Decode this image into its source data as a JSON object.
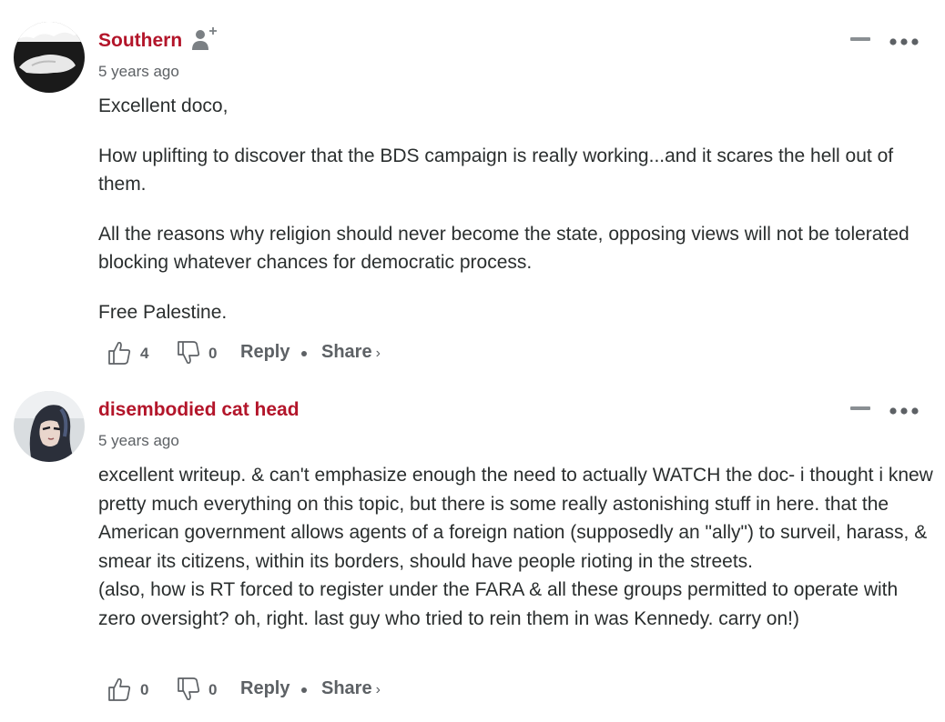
{
  "comments": [
    {
      "author": "Southern",
      "time": "5 years ago",
      "paragraphs": [
        "Excellent doco,",
        "How uplifting to discover that the BDS campaign is really working...and it scares the hell out of them.",
        "All the reasons why religion should never become the state, opposing views will not be tolerated blocking whatever chances for democratic process.",
        "Free Palestine."
      ],
      "upvotes": "4",
      "downvotes": "0",
      "reply_label": "Reply",
      "share_label": "Share",
      "share_chevron": "›"
    },
    {
      "author": "disembodied cat head",
      "time": "5 years ago",
      "text": "excellent writeup. & can't emphasize enough the need to actually WATCH the doc- i thought i knew pretty much everything on this topic, but there is some really astonishing stuff in here. that the American government allows agents of a foreign nation (supposedly an \"ally\") to surveil, harass, & smear its citizens, within its borders, should have people rioting in the streets.\n(also, how is RT forced to register under the FARA & all these groups permitted to operate with zero oversight? oh, right. last guy who tried to rein them in was Kennedy. carry on!)",
      "upvotes": "0",
      "downvotes": "0",
      "reply_label": "Reply",
      "share_label": "Share",
      "share_chevron": "›"
    }
  ],
  "colors": {
    "author": "#b3152a",
    "meta": "#5d6165",
    "text": "#2a2e2e"
  },
  "icons": [
    "follow-user-icon",
    "collapse-icon",
    "more-options-icon",
    "thumbs-up-icon",
    "thumbs-down-icon"
  ]
}
